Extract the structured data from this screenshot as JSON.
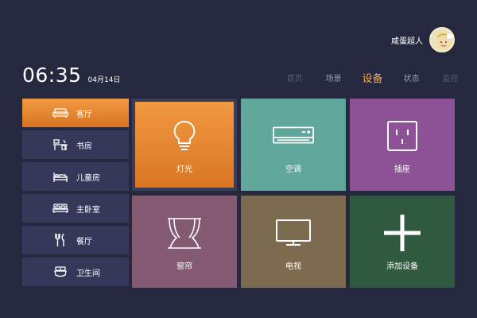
{
  "user": {
    "name": "咸蛋超人",
    "avatar_icon": "avatar-icon"
  },
  "clock": {
    "time": "06:35",
    "date": "04月14日"
  },
  "nav": {
    "tabs": [
      {
        "label": "首页",
        "state": "dim"
      },
      {
        "label": "场景",
        "state": "normal"
      },
      {
        "label": "设备",
        "state": "active"
      },
      {
        "label": "状态",
        "state": "normal"
      },
      {
        "label": "监控",
        "state": "dim"
      }
    ]
  },
  "sidebar": {
    "items": [
      {
        "label": "客厅",
        "icon": "sofa-icon",
        "active": true
      },
      {
        "label": "书房",
        "icon": "desk-icon",
        "active": false
      },
      {
        "label": "儿童房",
        "icon": "bed-icon",
        "active": false
      },
      {
        "label": "主卧室",
        "icon": "bed-double-icon",
        "active": false
      },
      {
        "label": "餐厅",
        "icon": "fork-knife-icon",
        "active": false
      },
      {
        "label": "卫生间",
        "icon": "toilet-icon",
        "active": false
      }
    ]
  },
  "devices": {
    "tiles": [
      {
        "label": "灯光",
        "icon": "lightbulb-icon",
        "color": "#e5842f"
      },
      {
        "label": "空调",
        "icon": "air-conditioner-icon",
        "color": "#5fa69b"
      },
      {
        "label": "插座",
        "icon": "socket-icon",
        "color": "#8d5196"
      },
      {
        "label": "窗帘",
        "icon": "curtain-icon",
        "color": "#845a72"
      },
      {
        "label": "电视",
        "icon": "tv-icon",
        "color": "#7d6b4f"
      },
      {
        "label": "添加设备",
        "icon": "plus-icon",
        "color": "#2f5a3f"
      }
    ]
  },
  "colors": {
    "background": "#262840",
    "accent": "#f0a850",
    "sidebar": "#36385a"
  }
}
